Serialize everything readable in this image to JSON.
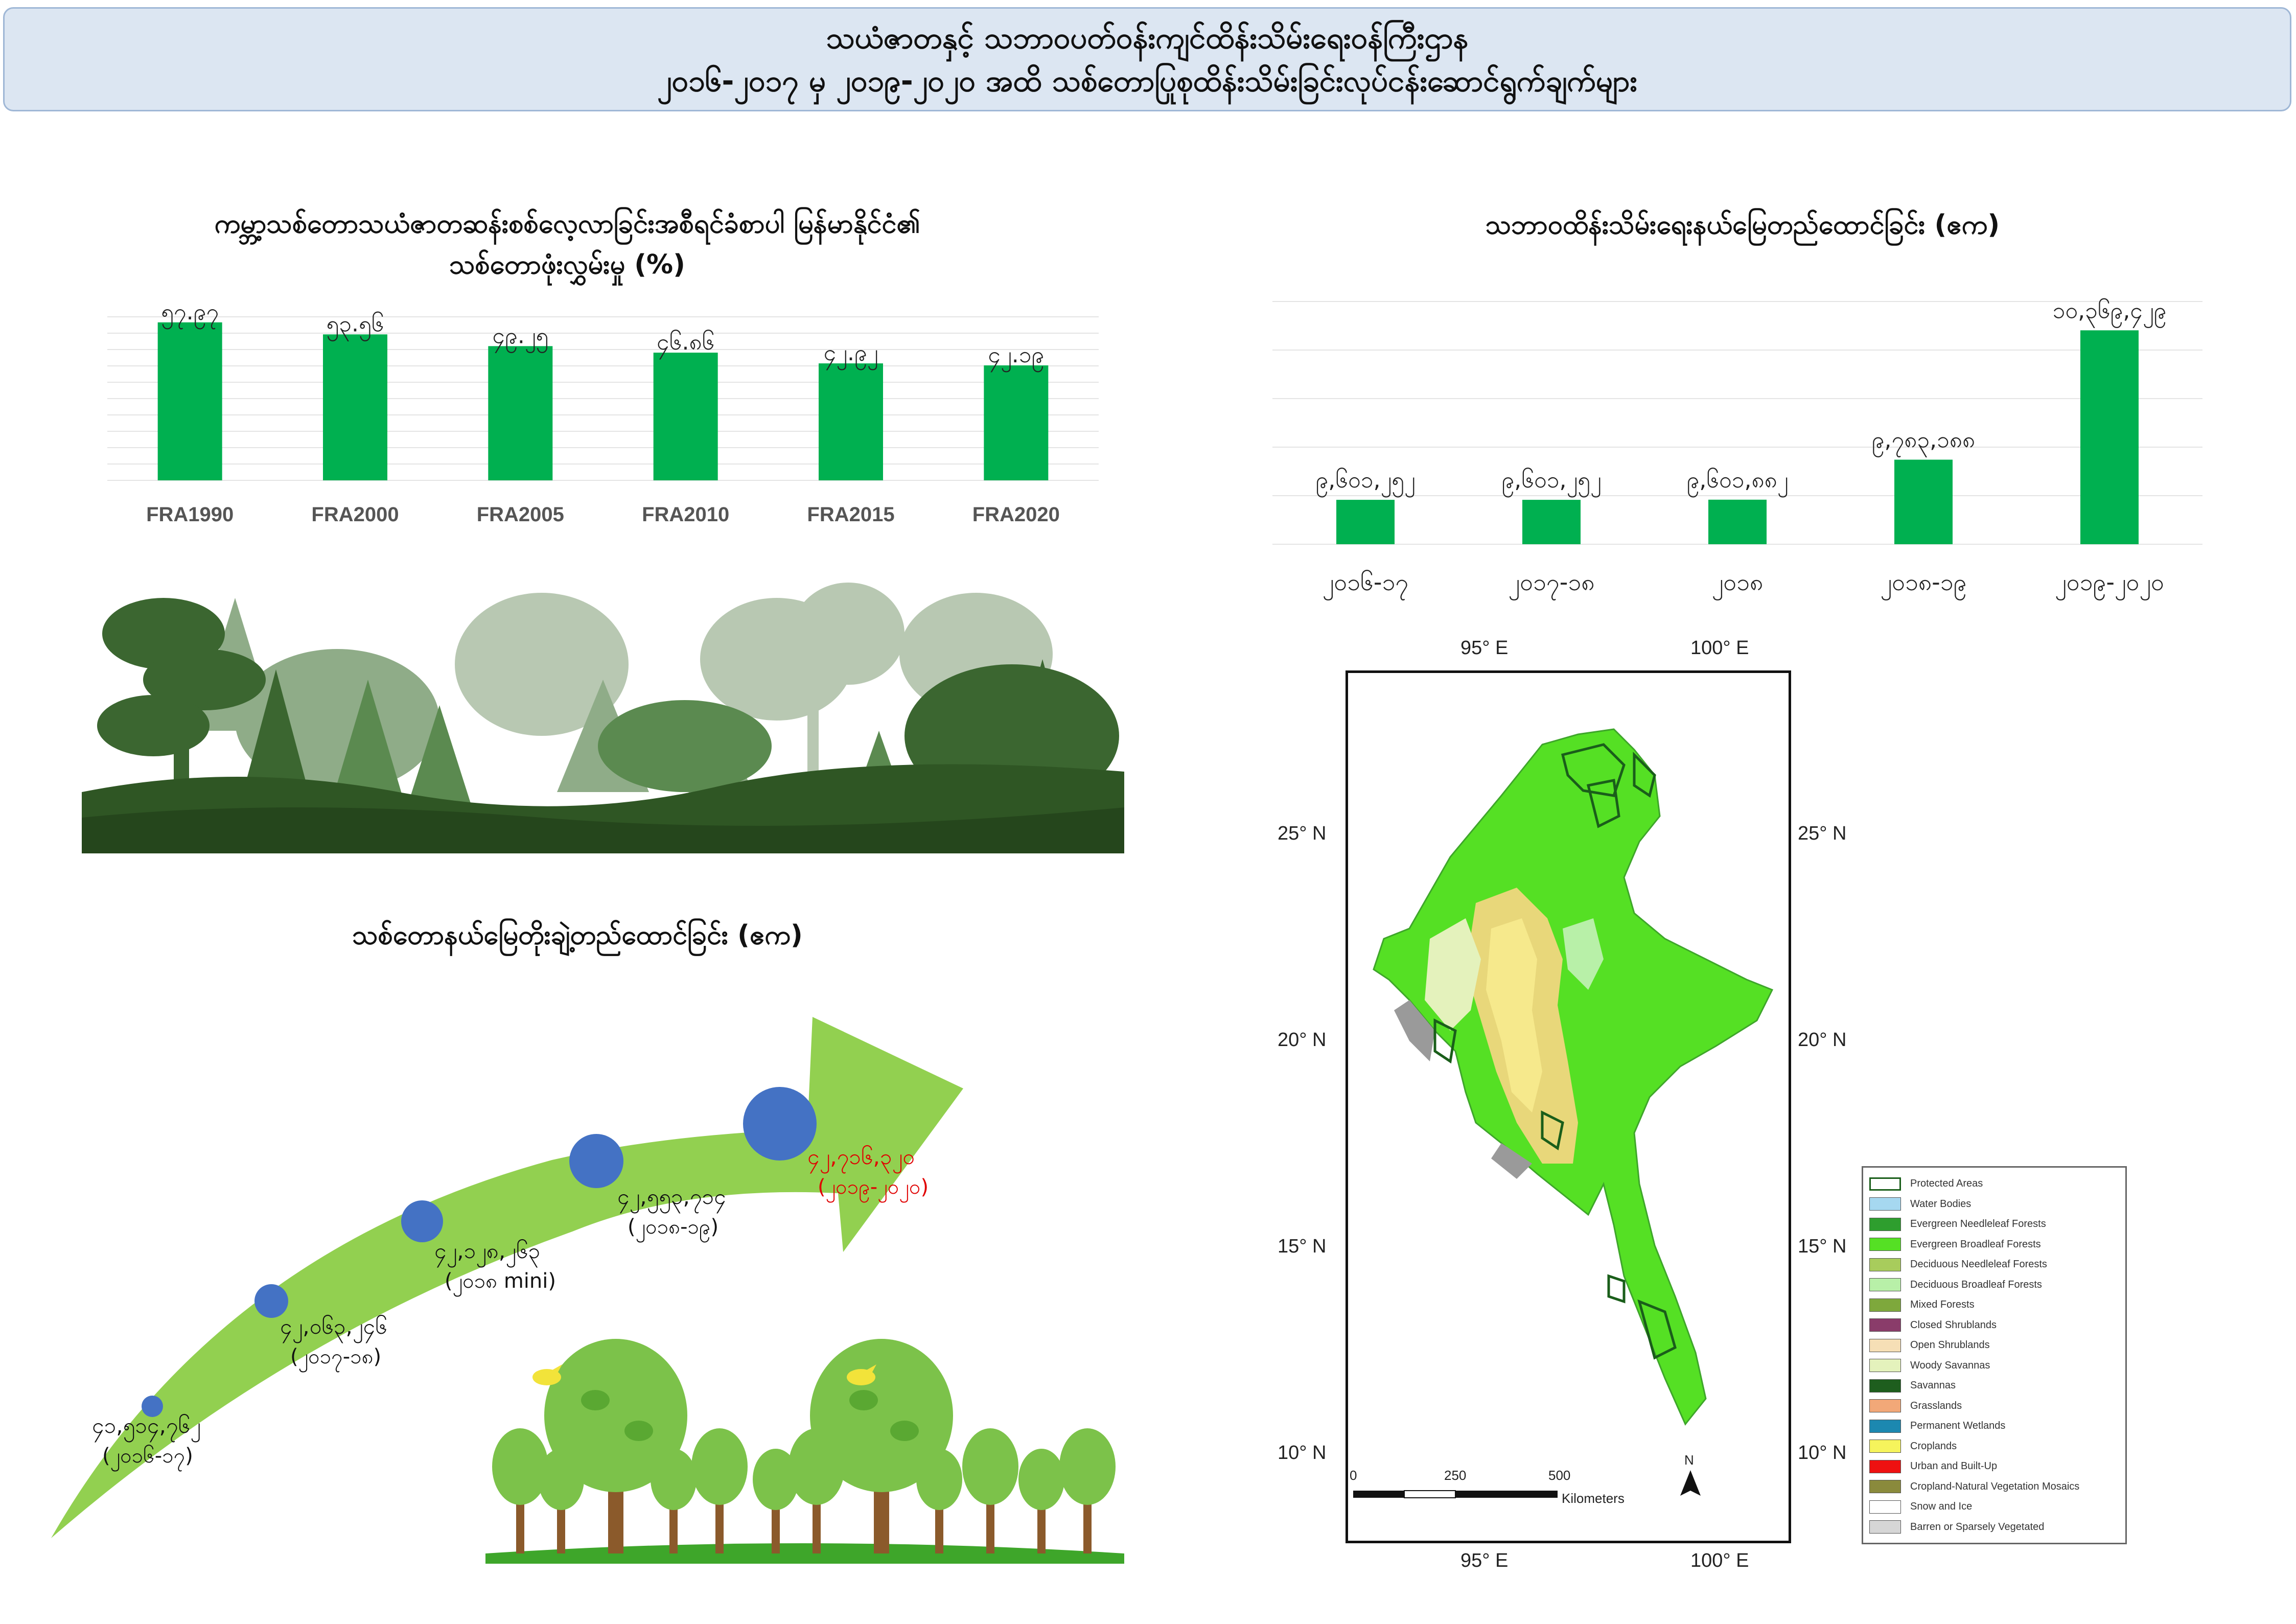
{
  "banner": {
    "line1": "သယံဇာတနှင့် သဘာဝပတ်ဝန်းကျင်ထိန်းသိမ်းရေးဝန်ကြီးဌာန",
    "line2": "၂၀၁၆-၂၀၁၇ မှ ၂၀၁၉-၂၀၂၀ အထိ သစ်တောပြုစုထိန်းသိမ်းခြင်းလုပ်ငန်းဆောင်ရွက်ချက်များ"
  },
  "left_top": {
    "title_line1": "ကမ္ဘာ့သစ်တောသယံဇာတဆန်းစစ်လေ့လာခြင်းအစီရင်ခံစာပါ မြန်မာနိုင်ငံ၏",
    "title_line2": "သစ်တောဖုံးလွှမ်းမှု (%)"
  },
  "right_top": {
    "title": "သဘာဝထိန်းသိမ်းရေးနယ်မြေတည်ထောင်ခြင်း (ဧက)"
  },
  "growth": {
    "title": "သစ်တောနယ်မြေတိုးချဲ့တည်ထောင်ခြင်း (ဧက)",
    "points": [
      {
        "value": "၄၁,၅၁၄,၇၆၂",
        "year": "(၂၀၁၆-၁၇)",
        "highlight": false
      },
      {
        "value": "၄၂,၀၆၃,၂၄၆",
        "year": "(၂၀၁၇-၁၈)",
        "highlight": false
      },
      {
        "value": "၄၂,၁၂၈,၂၆၃",
        "year": "(၂၀၁၈ mini)",
        "highlight": false
      },
      {
        "value": "၄၂,၅၅၃,၇၁၄",
        "year": "(၂၀၁၈-၁၉)",
        "highlight": false
      },
      {
        "value": "၄၂,၇၁၆,၃၂၀",
        "year": "(၂၀၁၉-၂၀၂၀)",
        "highlight": true
      }
    ]
  },
  "colors": {
    "bar_green": "#00b050",
    "highlight_red": "#e00000",
    "bubble_blue": "#4472c4",
    "arrow_green": "#92d050",
    "banner_bg": "#dce6f2"
  },
  "map": {
    "top_ticks": [
      "95° E",
      "100° E"
    ],
    "bottom_ticks": [
      "95° E",
      "100° E"
    ],
    "lat_ticks": [
      "25° N",
      "20° N",
      "15° N",
      "10° N"
    ],
    "scalebar": {
      "labels": [
        "0",
        "250",
        "500"
      ],
      "unit": "Kilometers"
    },
    "north": "N",
    "legend": [
      {
        "label": "Protected Areas",
        "color": "#ffffff",
        "border": "#1a5e1a"
      },
      {
        "label": "Water Bodies",
        "color": "#a6d8f0"
      },
      {
        "label": "Evergreen Needleleaf Forests",
        "color": "#2e9e2e"
      },
      {
        "label": "Evergreen Broadleaf Forests",
        "color": "#55e024"
      },
      {
        "label": "Deciduous Needleleaf Forests",
        "color": "#a8cc5c"
      },
      {
        "label": "Deciduous Broadleaf Forests",
        "color": "#b8f0a8"
      },
      {
        "label": "Mixed Forests",
        "color": "#7ea83c"
      },
      {
        "label": "Closed Shrublands",
        "color": "#8a3c6a"
      },
      {
        "label": "Open Shrublands",
        "color": "#f6dfb6"
      },
      {
        "label": "Woody Savannas",
        "color": "#e4f2bc"
      },
      {
        "label": "Savannas",
        "color": "#1e5e1e"
      },
      {
        "label": "Grasslands",
        "color": "#f2a878"
      },
      {
        "label": "Permanent Wetlands",
        "color": "#1c88b0"
      },
      {
        "label": "Croplands",
        "color": "#f6f45c"
      },
      {
        "label": "Urban and Built-Up",
        "color": "#ee1111"
      },
      {
        "label": "Cropland-Natural Vegetation Mosaics",
        "color": "#8a8a3c"
      },
      {
        "label": "Snow and Ice",
        "color": "#ffffff"
      },
      {
        "label": "Barren or Sparsely Vegetated",
        "color": "#d6d6d6"
      }
    ]
  },
  "chart_data": [
    {
      "type": "bar",
      "title": "ကမ္ဘာ့သစ်တောသယံဇာတဆန်းစစ်လေ့လာခြင်းအစီရင်ခံစာပါ မြန်မာနိုင်ငံ၏ သစ်တောဖုံးလွှမ်းမှု (%)",
      "categories": [
        "FRA1990",
        "FRA2000",
        "FRA2005",
        "FRA2010",
        "FRA2015",
        "FRA2020"
      ],
      "values": [
        57.97,
        53.56,
        49.25,
        46.86,
        42.92,
        42.19
      ],
      "data_labels": [
        "၅၇.၉၇",
        "၅၃.၅၆",
        "၄၉.၂၅",
        "၄၆.၈၆",
        "၄၂.၉၂",
        "၄၂.၁၉"
      ],
      "highlight_index": 5,
      "ylim": [
        0,
        60
      ],
      "grid": true
    },
    {
      "type": "bar",
      "title": "သဘာဝထိန်းသိမ်းရေးနယ်မြေတည်ထောင်ခြင်း (ဧက)",
      "categories": [
        "၂၀၁၆-၁၇",
        "၂၀၁၇-၁၈",
        "၂၀၁၈",
        "၂၀၁၈-၁၉",
        "၂၀၁၉-၂၀၂၀"
      ],
      "values": [
        9601252,
        9601252,
        9601882,
        9783188,
        10369429
      ],
      "data_labels": [
        "၉,၆၀၁,၂၅၂",
        "၉,၆၀၁,၂၅၂",
        "၉,၆၀၁,၈၈၂",
        "၉,၇၈၃,၁၈၈",
        "၁၀,၃၆၉,၄၂၉"
      ],
      "highlight_index": 4,
      "ylim": [
        9400000,
        10500000
      ],
      "grid": true
    }
  ]
}
